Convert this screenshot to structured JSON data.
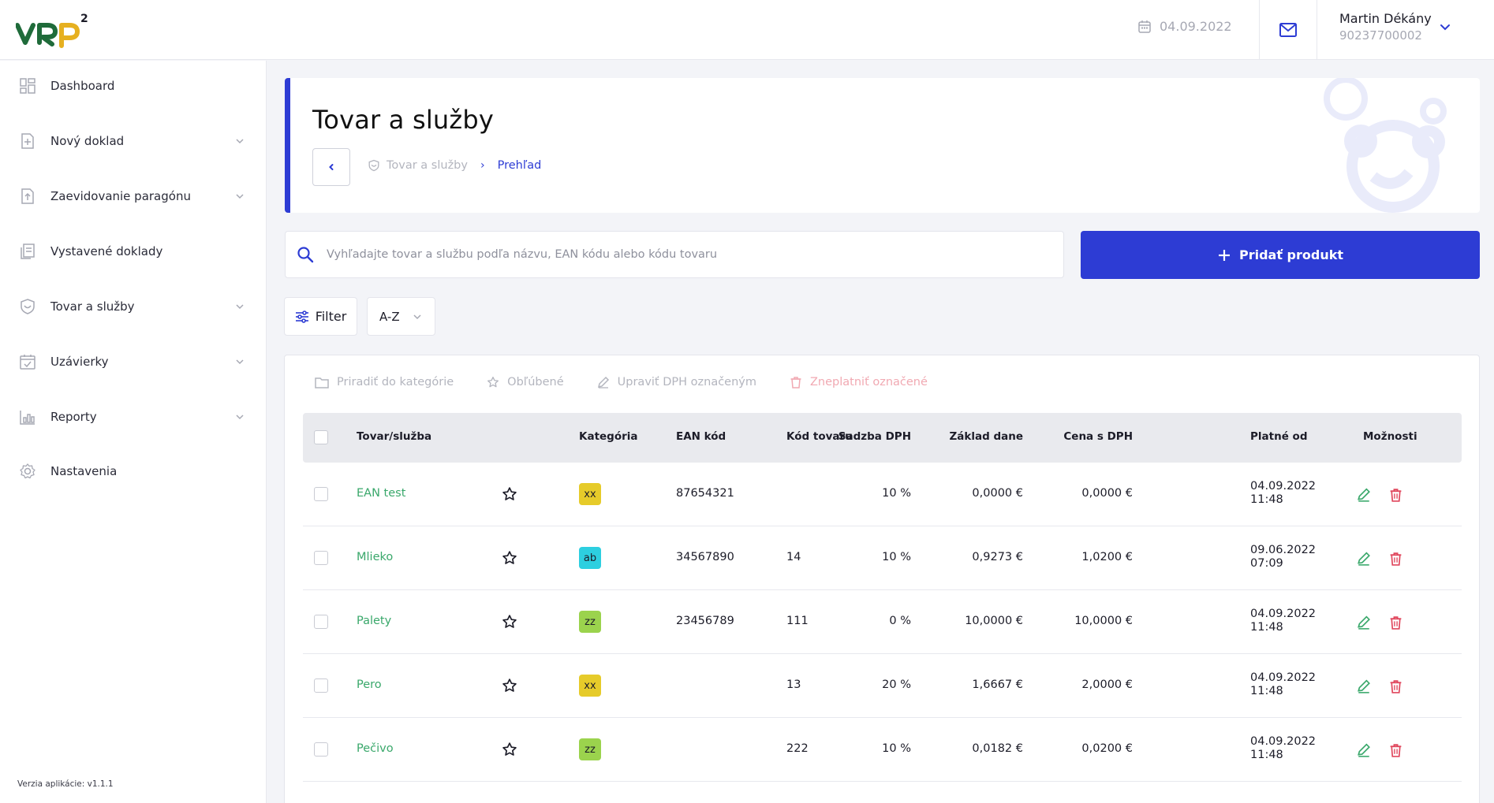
{
  "app": {
    "logo_text": "VRP",
    "logo_superscript": "2"
  },
  "topbar": {
    "date": "04.09.2022",
    "user_name": "Martin Dékány",
    "user_id": "90237700002"
  },
  "sidebar": {
    "items": [
      {
        "label": "Dashboard",
        "icon": "dashboard-icon",
        "has_chevron": false
      },
      {
        "label": "Nový doklad",
        "icon": "new-document-icon",
        "has_chevron": true
      },
      {
        "label": "Zaevidovanie paragónu",
        "icon": "upload-document-icon",
        "has_chevron": true
      },
      {
        "label": "Vystavené doklady",
        "icon": "documents-icon",
        "has_chevron": false
      },
      {
        "label": "Tovar a služby",
        "icon": "shield-icon",
        "has_chevron": true
      },
      {
        "label": "Uzávierky",
        "icon": "calendar-check-icon",
        "has_chevron": true
      },
      {
        "label": "Reporty",
        "icon": "bar-chart-icon",
        "has_chevron": true
      },
      {
        "label": "Nastavenia",
        "icon": "gear-icon",
        "has_chevron": false
      }
    ],
    "version": "Verzia aplikácie: v1.1.1"
  },
  "header": {
    "title": "Tovar a služby",
    "breadcrumb_1": "Tovar a služby",
    "breadcrumb_2": "Prehľad"
  },
  "search": {
    "placeholder": "Vyhľadajte tovar a službu podľa názvu, EAN kódu alebo kódu tovaru",
    "value": ""
  },
  "actions": {
    "add_product": "Pridať produkt",
    "filter": "Filter",
    "sort": "A-Z"
  },
  "bulk_actions": {
    "assign_category": "Priradiť do kategórie",
    "favorite": "Obľúbené",
    "edit_vat": "Upraviť DPH označeným",
    "invalidate": "Zneplatniť označené"
  },
  "table": {
    "columns": {
      "product": "Tovar/služba",
      "category": "Kategória",
      "ean": "EAN kód",
      "code": "Kód tovaru",
      "vat_rate": "Sadzba DPH",
      "tax_base": "Základ dane",
      "price_vat": "Cena s DPH",
      "valid_from": "Platné od",
      "options": "Možnosti"
    },
    "rows": [
      {
        "name": "EAN test",
        "category": "xx",
        "category_color": "#e6cb2a",
        "ean": "87654321",
        "code": "",
        "vat": "10 %",
        "base": "0,0000 €",
        "price": "0,0000 €",
        "date": "04.09.2022",
        "time": "11:48"
      },
      {
        "name": "Mlieko",
        "category": "ab",
        "category_color": "#2dcfe0",
        "ean": "34567890",
        "code": "14",
        "vat": "10 %",
        "base": "0,9273 €",
        "price": "1,0200 €",
        "date": "09.06.2022",
        "time": "07:09"
      },
      {
        "name": "Palety",
        "category": "zz",
        "category_color": "#9bd34d",
        "ean": "23456789",
        "code": "111",
        "vat": "0 %",
        "base": "10,0000 €",
        "price": "10,0000 €",
        "date": "04.09.2022",
        "time": "11:48"
      },
      {
        "name": "Pero",
        "category": "xx",
        "category_color": "#e6cb2a",
        "ean": "",
        "code": "13",
        "vat": "20 %",
        "base": "1,6667 €",
        "price": "2,0000 €",
        "date": "04.09.2022",
        "time": "11:48"
      },
      {
        "name": "Pečivo",
        "category": "zz",
        "category_color": "#9bd34d",
        "ean": "",
        "code": "222",
        "vat": "10 %",
        "base": "0,0182 €",
        "price": "0,0200 €",
        "date": "04.09.2022",
        "time": "11:48"
      }
    ]
  },
  "colors": {
    "primary": "#2d3cd4",
    "name_green": "#3aa86b",
    "edit_green": "#3aa86b",
    "delete_red": "#e0475d"
  }
}
